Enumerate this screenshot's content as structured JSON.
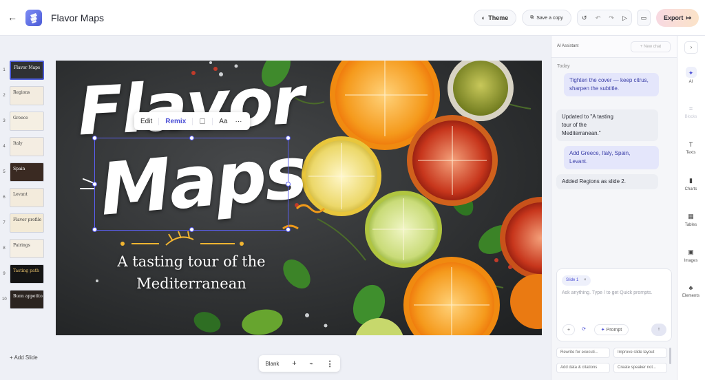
{
  "header": {
    "doc_title": "Flavor Maps",
    "theme_label": "Theme",
    "save_copy_label": "Save a copy",
    "export_label": "Export"
  },
  "thumbnails": [
    {
      "num": "1",
      "label": "Flavor Maps",
      "bg": "#2f3133",
      "fg": "#ffffff",
      "active": true
    },
    {
      "num": "2",
      "label": "Regions",
      "bg": "#f3ece0",
      "fg": "#3a3a3a"
    },
    {
      "num": "3",
      "label": "Greece",
      "bg": "#f5efe3",
      "fg": "#3a3a3a"
    },
    {
      "num": "4",
      "label": "Italy",
      "bg": "#f4ede2",
      "fg": "#3a3a3a"
    },
    {
      "num": "5",
      "label": "Spain",
      "bg": "#3a2a22",
      "fg": "#ffffff"
    },
    {
      "num": "6",
      "label": "Levant",
      "bg": "#f3ebdc",
      "fg": "#3a3a3a"
    },
    {
      "num": "7",
      "label": "Flavor profile",
      "bg": "#f3ead6",
      "fg": "#3a3a3a"
    },
    {
      "num": "8",
      "label": "Pairings",
      "bg": "#f5efe4",
      "fg": "#3a3a3a"
    },
    {
      "num": "9",
      "label": "Tasting path",
      "bg": "#151515",
      "fg": "#e8c06a"
    },
    {
      "num": "10",
      "label": "Buon appetito",
      "bg": "#2b2420",
      "fg": "#ffffff"
    }
  ],
  "add_slide_label": "+ Add Slide",
  "slide": {
    "title_line1": "Flavor",
    "title_line2": "Maps",
    "subtitle": "A tasting tour of the Mediterranean"
  },
  "float_toolbar": {
    "edit": "Edit",
    "remix": "Remix",
    "font": "Aa",
    "more": "···"
  },
  "bottom_toolbar": {
    "layout_label": "Blank",
    "add": "+",
    "more": "⋮"
  },
  "ai": {
    "title": "AI Assistant",
    "new_chat": "+ New chat",
    "today": "Today",
    "messages": [
      {
        "role": "user",
        "text": "Tighten the cover — keep citrus, sharpen the subtitle."
      },
      {
        "role": "bot",
        "text": "Updated to \"A tasting tour of the Mediterranean.\""
      },
      {
        "role": "user",
        "text": "Add Greece, Italy, Spain, Levant."
      },
      {
        "role": "bot",
        "text": "Added Regions as slide 2."
      }
    ],
    "chip": "Slide 1",
    "placeholder": "Ask anything. Type / to get Quick prompts.",
    "add": "+",
    "prompt_label": "Prompt",
    "send": "↑",
    "suggestions": [
      "Rewrite for executi...",
      "Improve slide layout",
      "Add data & citations",
      "Create speaker not..."
    ]
  },
  "rail": [
    {
      "label": "AI",
      "icon": "✦",
      "state": "active"
    },
    {
      "label": "Blocks",
      "icon": "≡",
      "state": "dim"
    },
    {
      "label": "Texts",
      "icon": "T",
      "state": "normal"
    },
    {
      "label": "Charts",
      "icon": "▮",
      "state": "normal"
    },
    {
      "label": "Tables",
      "icon": "▦",
      "state": "normal"
    },
    {
      "label": "Images",
      "icon": "▣",
      "state": "normal"
    },
    {
      "label": "Elements",
      "icon": "♣",
      "state": "normal"
    }
  ]
}
